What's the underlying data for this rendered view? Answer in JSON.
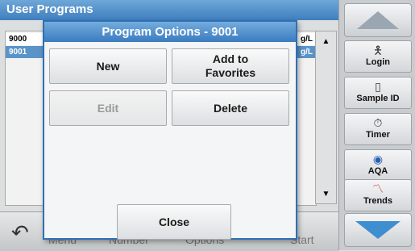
{
  "background": {
    "title": "User Programs",
    "rows": [
      {
        "id": "9000",
        "unit": "g/L"
      },
      {
        "id": "9001",
        "unit": "g/L"
      }
    ],
    "bottom_labels": [
      "Menu",
      "Number",
      "Options",
      "Start"
    ]
  },
  "sidebar": {
    "login": "Login",
    "sample_id": "Sample ID",
    "timer": "Timer",
    "aqa": "AQA",
    "trends": "Trends"
  },
  "dialog": {
    "title": "Program Options - 9001",
    "new_label": "New",
    "add_favorites_label": "Add to Favorites",
    "edit_label": "Edit",
    "delete_label": "Delete",
    "close_label": "Close"
  },
  "colors": {
    "title_bar": "#3f7fbf",
    "selected_row": "#5a93c8",
    "scroll_down_arrow": "#3f8ed0"
  }
}
